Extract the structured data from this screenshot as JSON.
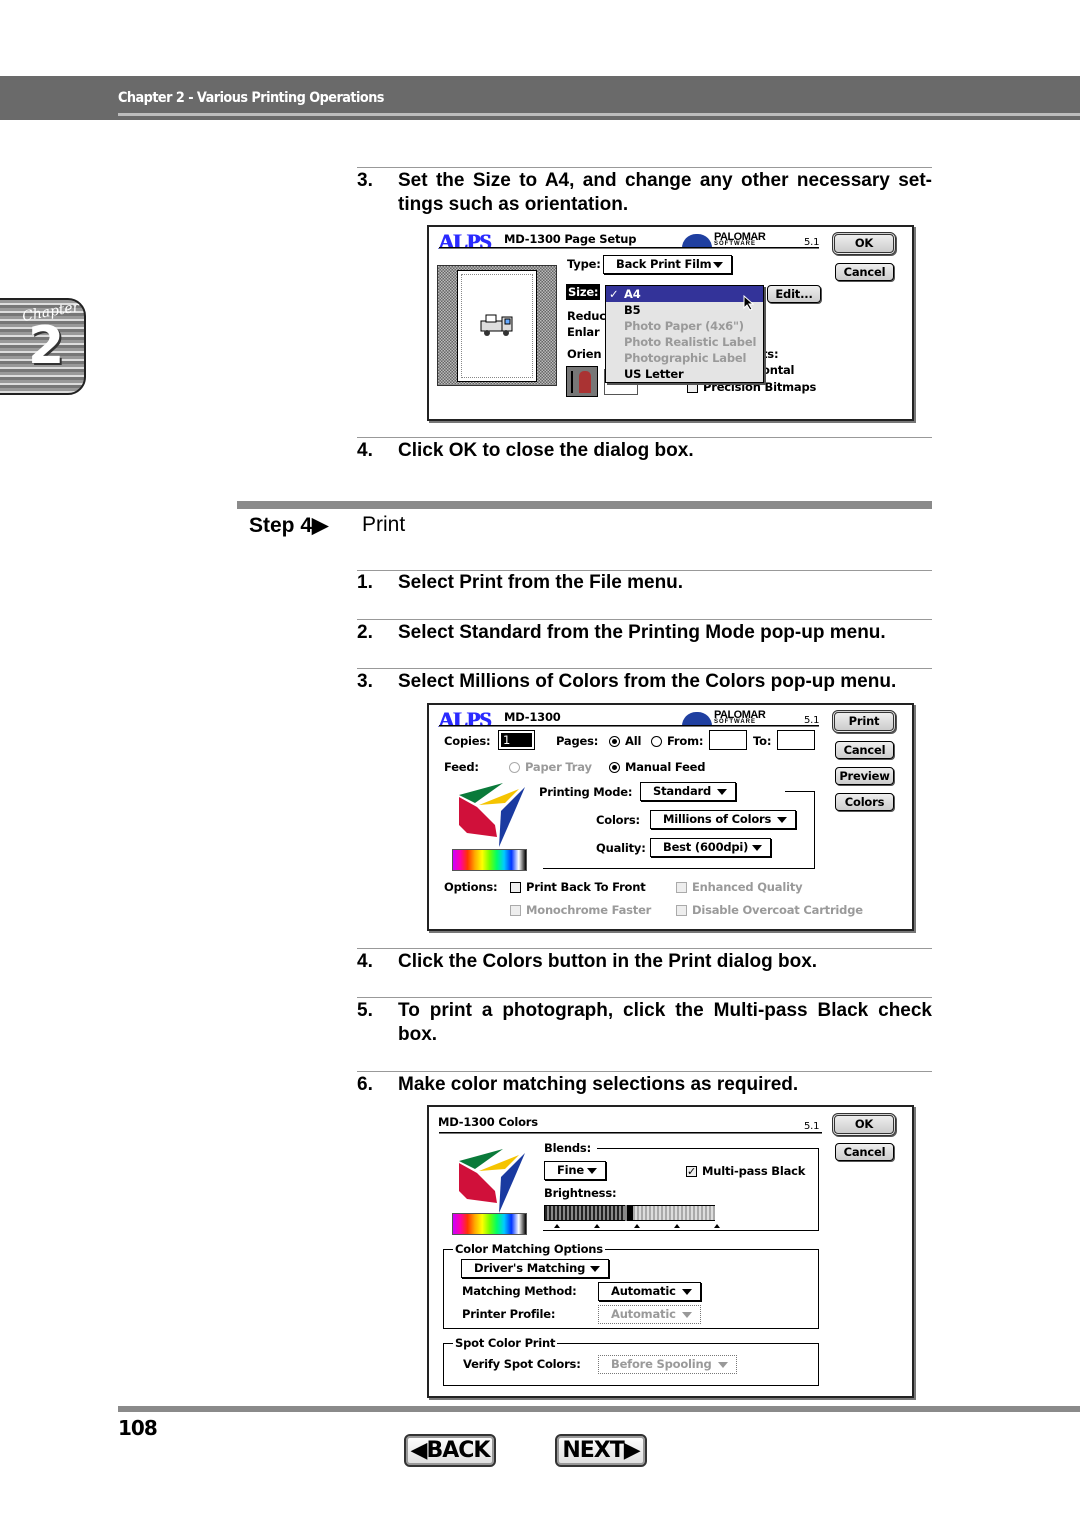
{
  "header": {
    "title": "Chapter 2 - Various Printing Operations"
  },
  "chapter_tab": {
    "label": "Chapter",
    "number": "2"
  },
  "section_a": {
    "steps": [
      {
        "num": "3.",
        "text": "Set the Size to A4, and change any other necessary set­tings such as orientation."
      },
      {
        "num": "4.",
        "text": "Click OK to close the dialog box."
      }
    ]
  },
  "step_heading": {
    "label": "Step 4▶",
    "title": "Print"
  },
  "section_b": {
    "steps": [
      {
        "num": "1.",
        "text": "Select Print from the File menu."
      },
      {
        "num": "2.",
        "text": "Select Standard from the Printing Mode pop-up menu."
      },
      {
        "num": "3.",
        "text": "Select Millions of Colors from the Colors pop-up menu."
      },
      {
        "num": "4.",
        "text": "Click the Colors button in the Print dialog box."
      },
      {
        "num": "5.",
        "text": "To print a photograph, click the Multi-pass Black check box."
      },
      {
        "num": "6.",
        "text": "Make color matching selections as required."
      }
    ]
  },
  "logos": {
    "alps": "ALPS",
    "palomar": "PALOMAR",
    "palomar_sub": "SOFTWARE"
  },
  "page_setup": {
    "title": "MD-1300 Page Setup",
    "version": "5.1",
    "ok": "OK",
    "cancel": "Cancel",
    "type_label": "Type:",
    "type_value": "Back Print Film",
    "size_label": "Size:",
    "edit": "Edit...",
    "size_menu": [
      {
        "label": "A4",
        "selected": true,
        "enabled": true
      },
      {
        "label": "B5",
        "enabled": true
      },
      {
        "label": "Photo Paper (4x6\")",
        "enabled": false
      },
      {
        "label": "Photo Realistic Label",
        "enabled": false
      },
      {
        "label": "Photographic Label",
        "enabled": false
      },
      {
        "label": "US Letter",
        "enabled": true
      }
    ],
    "check_mark": "✓",
    "partial_labels": [
      "Reduc",
      "Enlar",
      "Orien",
      "ts:",
      "ontal"
    ],
    "precision_bitmaps": "Precision Bitmaps"
  },
  "print_dialog": {
    "title": "MD-1300",
    "version": "5.1",
    "buttons": [
      "Print",
      "Cancel",
      "Preview",
      "Colors"
    ],
    "copies_label": "Copies:",
    "copies_value": "1",
    "pages_label": "Pages:",
    "all": "All",
    "from": "From:",
    "to": "To:",
    "feed_label": "Feed:",
    "paper_tray": "Paper Tray",
    "manual_feed": "Manual Feed",
    "printing_mode_label": "Printing Mode:",
    "printing_mode_value": "Standard",
    "colors_label": "Colors:",
    "colors_value": "Millions of Colors",
    "quality_label": "Quality:",
    "quality_value": "Best (600dpi)",
    "options_label": "Options:",
    "options": [
      {
        "label": "Print Back To Front",
        "checked": false,
        "enabled": true
      },
      {
        "label": "Enhanced Quality",
        "checked": false,
        "enabled": false
      },
      {
        "label": "Monochrome Faster",
        "checked": false,
        "enabled": false
      },
      {
        "label": "Disable Overcoat Cartridge",
        "checked": false,
        "enabled": false
      }
    ]
  },
  "colors_dialog": {
    "title": "MD-1300 Colors",
    "version": "5.1",
    "ok": "OK",
    "cancel": "Cancel",
    "blends_label": "Blends:",
    "blends_value": "Fine",
    "multipass_black": "Multi-pass Black",
    "multipass_checked": true,
    "check_mark": "✓",
    "brightness_label": "Brightness:",
    "brightness_level": 0.5,
    "color_matching_group": "Color Matching Options",
    "matching_source": "Driver's Matching",
    "matching_method_label": "Matching Method:",
    "matching_method_value": "Automatic",
    "printer_profile_label": "Printer Profile:",
    "printer_profile_value": "Automatic",
    "spot_group": "Spot Color Print",
    "verify_label": "Verify Spot Colors:",
    "verify_value": "Before Spooling"
  },
  "footer": {
    "page_number": "108",
    "back": "◀BACK",
    "next": "NEXT▶"
  },
  "colors": {
    "header_bg": "#6a6a6a",
    "alps_blue": "#2a2aff",
    "menu_highlight": "#333399"
  }
}
